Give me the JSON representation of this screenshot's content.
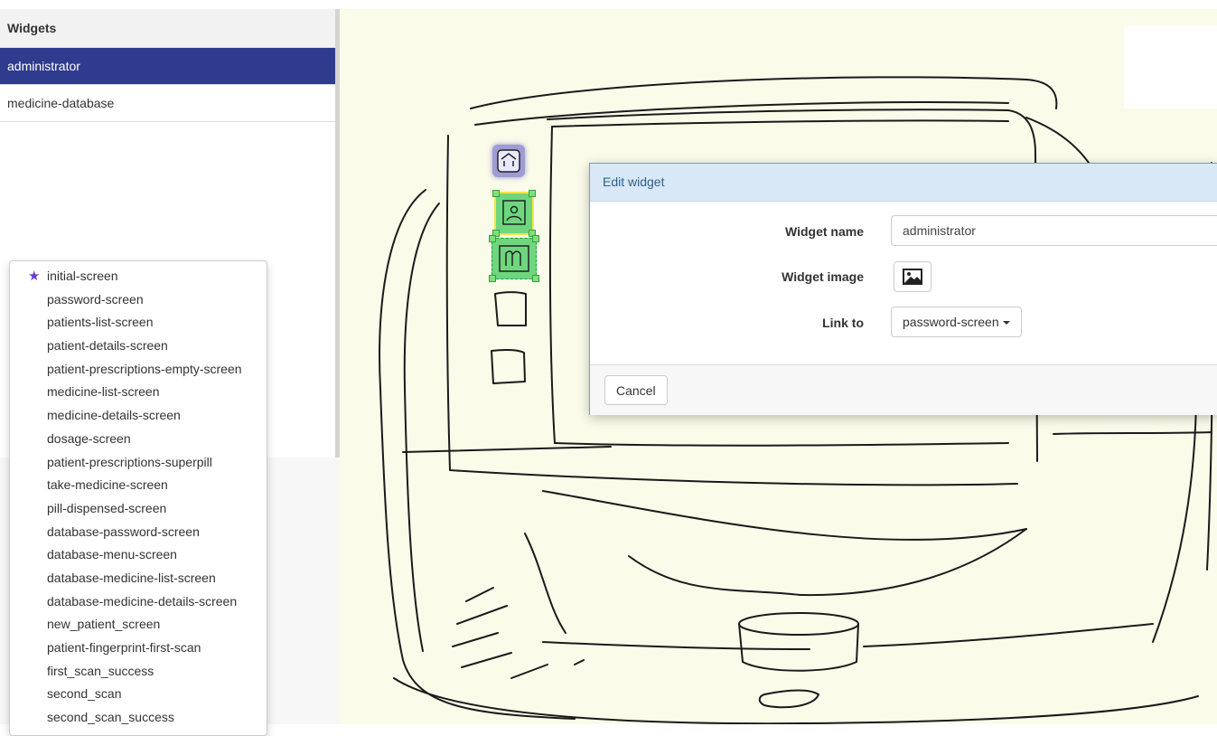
{
  "widgets_panel": {
    "title": "Widgets",
    "items": [
      {
        "label": "administrator",
        "selected": true
      },
      {
        "label": "medicine-database",
        "selected": false
      }
    ]
  },
  "screens_menu": {
    "initial_icon": "star-icon",
    "items": [
      "initial-screen",
      "password-screen",
      "patients-list-screen",
      "patient-details-screen",
      "patient-prescriptions-empty-screen",
      "medicine-list-screen",
      "medicine-details-screen",
      "dosage-screen",
      "patient-prescriptions-superpill",
      "take-medicine-screen",
      "pill-dispensed-screen",
      "database-password-screen",
      "database-menu-screen",
      "database-medicine-list-screen",
      "database-medicine-details-screen",
      "new_patient_screen",
      "patient-fingerprint-first-scan",
      "first_scan_success",
      "second_scan",
      "second_scan_success"
    ]
  },
  "edit_dialog": {
    "title": "Edit widget",
    "name_label": "Widget name",
    "name_value": "administrator",
    "image_label": "Widget image",
    "image_icon": "image-icon",
    "link_label": "Link to",
    "link_value": "password-screen",
    "cancel_label": "Cancel"
  },
  "colors": {
    "selected_row": "#2e3b8f",
    "canvas_bg": "#fbfbea",
    "hotspot_green": "#32c850",
    "hotspot_blue": "#5050be",
    "star": "#6a3ad6"
  }
}
